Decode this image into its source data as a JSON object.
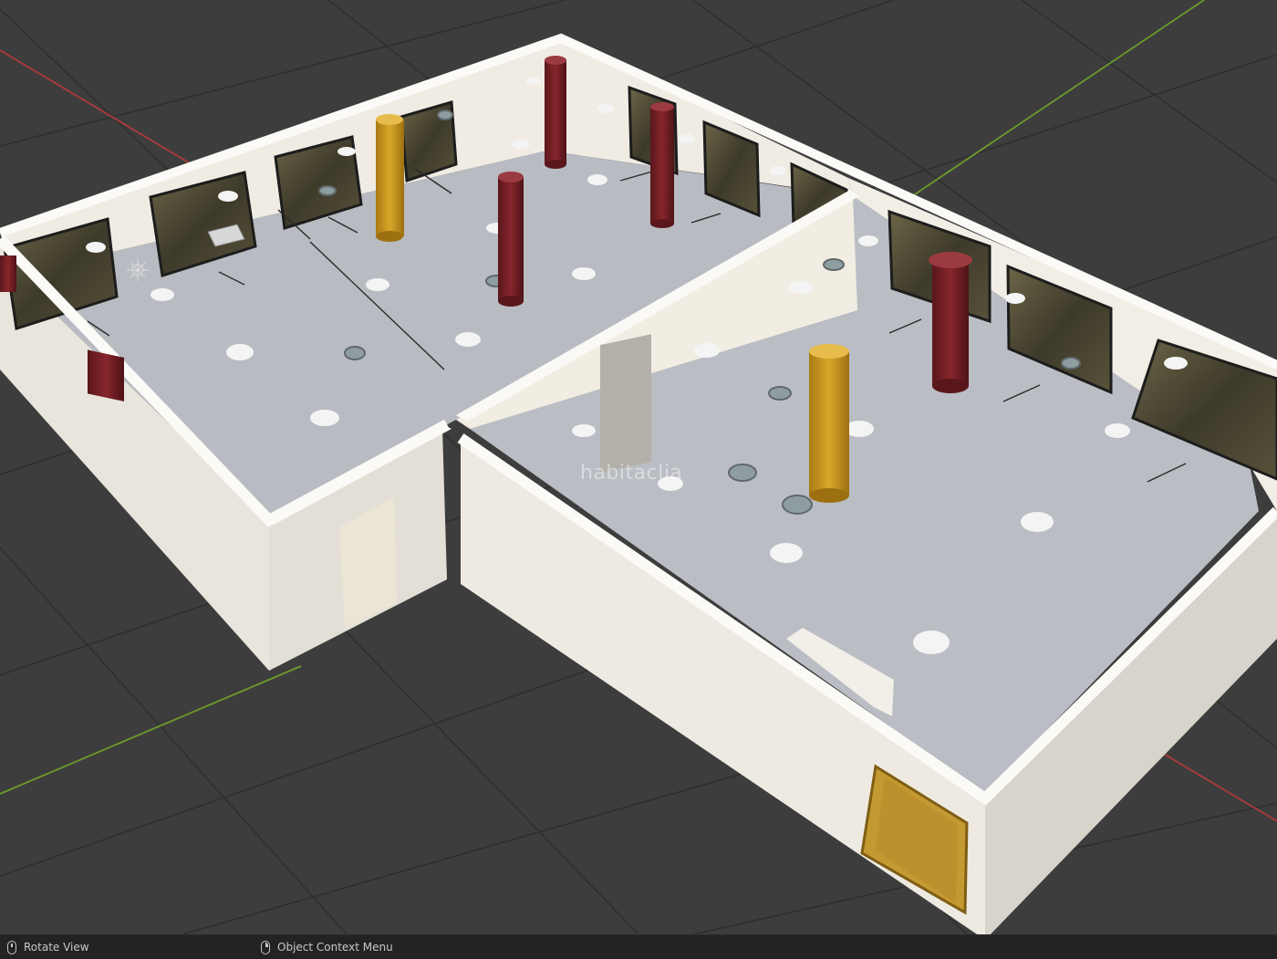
{
  "viewport": {
    "watermark": "habitaclia",
    "colors": {
      "background": "#3d3d3d",
      "grid": "#2f2f2f",
      "axis_x": "#b03a3a",
      "axis_y": "#6d9b2b",
      "wall": "#eeeae2",
      "floor": "#b9bcc2",
      "column_red": "#6f1f24",
      "column_yellow": "#c89a22",
      "door_wood": "#b88a2c"
    }
  },
  "statusbar": {
    "left_hint": "Rotate View",
    "right_hint": "Object Context Menu",
    "left_icon": "mouse-middle-icon",
    "right_icon": "mouse-right-icon"
  }
}
